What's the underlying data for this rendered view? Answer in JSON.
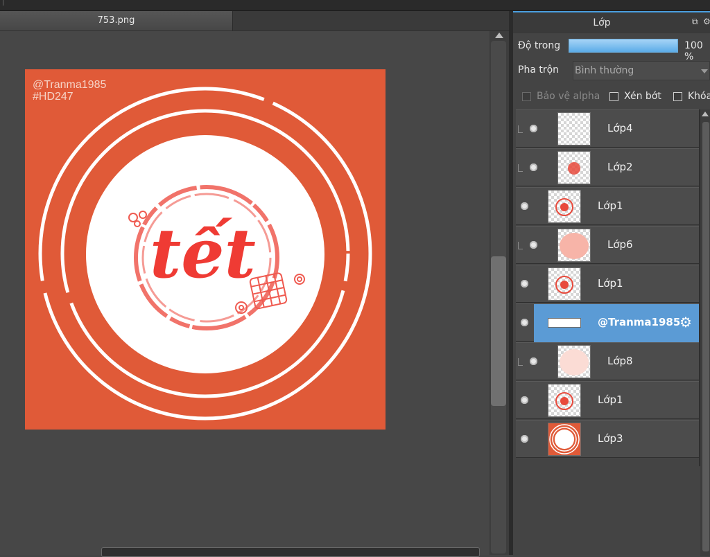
{
  "document": {
    "tab_title": "753.png"
  },
  "artwork": {
    "watermark_line1": "@Tranma1985",
    "watermark_line2": "#HD247",
    "center_text": "tết",
    "background_color": "#e05a38",
    "accent_color": "#ef3b34"
  },
  "layer_panel": {
    "title": "Lớp",
    "opacity_label": "Độ trong",
    "opacity_value": "100 %",
    "opacity": 1.0,
    "blend_label": "Pha trộn",
    "blend_value": "Bình thường",
    "checkboxes": [
      {
        "label": "Bảo vệ alpha",
        "checked": false,
        "enabled": false
      },
      {
        "label": "Xén bớt",
        "checked": false,
        "enabled": true
      },
      {
        "label": "Khóa",
        "checked": false,
        "enabled": true
      }
    ],
    "layers": [
      {
        "name": "Lớp4",
        "clipped": true,
        "selected": false,
        "thumb": "empty-icon"
      },
      {
        "name": "Lớp2",
        "clipped": true,
        "selected": false,
        "thumb": "red-blob-icon"
      },
      {
        "name": "Lớp1",
        "clipped": false,
        "selected": false,
        "thumb": "tet-logo-icon"
      },
      {
        "name": "Lớp6",
        "clipped": true,
        "selected": false,
        "thumb": "pink-ellipse-icon"
      },
      {
        "name": "Lớp1",
        "clipped": false,
        "selected": false,
        "thumb": "tet-logo-icon"
      },
      {
        "name": "@Tranma1985",
        "clipped": false,
        "selected": true,
        "thumb": "text-layer-icon"
      },
      {
        "name": "Lớp8",
        "clipped": true,
        "selected": false,
        "thumb": "light-pink-ellipse-icon"
      },
      {
        "name": "Lớp1",
        "clipped": false,
        "selected": false,
        "thumb": "tet-logo-icon"
      },
      {
        "name": "Lớp3",
        "clipped": false,
        "selected": false,
        "thumb": "rings-icon"
      }
    ]
  }
}
